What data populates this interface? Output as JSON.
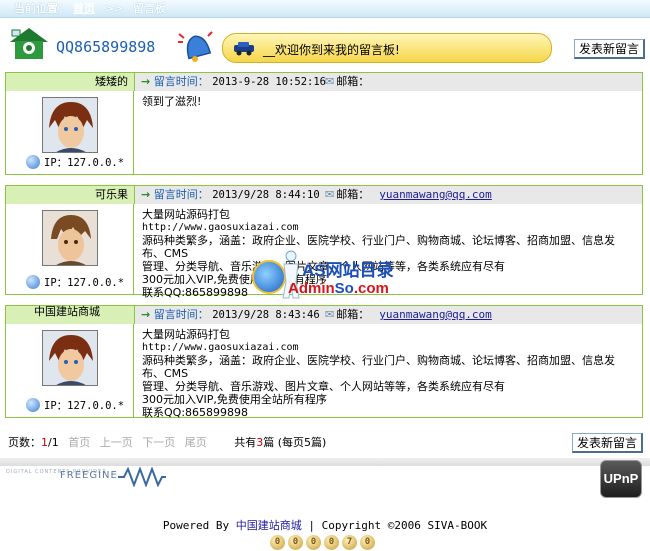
{
  "breadcrumb": {
    "label": "当前位置：",
    "home": "首页",
    "separator": ">>",
    "current": "留言板"
  },
  "header": {
    "qq": "QQ865899898",
    "welcome": "__欢迎你到来我的留言板!",
    "post_button": "发表新留言"
  },
  "labels": {
    "time": "留言时间：",
    "email": "邮箱：",
    "ip_prefix": "IP："
  },
  "messages": [
    {
      "name": "矮矮的",
      "time": "2013-9-28 10:52:16",
      "email": "",
      "ip": "127.0.0.*",
      "lines": [
        "领到了滋烈!"
      ]
    },
    {
      "name": "可乐果",
      "time": "2013/9/28 8:44:10",
      "email": "yuanmawang@qq.com",
      "ip": "127.0.0.*",
      "lines": [
        "大量网站源码打包",
        "http://www.gaosuxiazai.com",
        "源码种类繁多，涵盖：政府企业、医院学校、行业门户、购物商城、论坛博客、招商加盟、信息发布、CMS",
        "管理、分类导航、音乐游戏、图片文章、个人网站等等，各类系统应有尽有",
        "300元加入VIP,免费使用全站所有程序",
        "联系QQ:865899898"
      ]
    },
    {
      "name": "中国建站商城",
      "time": "2013/9/28 8:43:46",
      "email": "yuanmawang@qq.com",
      "ip": "127.0.0.*",
      "lines": [
        "大量网站源码打包",
        "http://www.gaosuxiazai.com",
        "源码种类繁多，涵盖：政府企业、医院学校、行业门户、购物商城、论坛博客、招商加盟、信息发布、CMS",
        "管理、分类导航、音乐游戏、图片文章、个人网站等等，各类系统应有尽有",
        "300元加入VIP,免费使用全站所有程序",
        "联系QQ:865899898"
      ]
    }
  ],
  "watermark": {
    "line1": "AS网站目录",
    "line2_a": "Admin",
    "line2_b": "So",
    "line2_c": ".com"
  },
  "pager": {
    "label": "页数：",
    "current": "1",
    "total_pages": "/1",
    "first": "首页",
    "prev": "上一页",
    "next": "下一页",
    "last": "尾页",
    "summary_a": "共有",
    "total": "3",
    "summary_b": "篇 (每页5篇)"
  },
  "footer": {
    "freegine_small": "DIGITAL CONTENTS PROVIDER",
    "freegine": "FREEGINE",
    "upnp": "UPnP",
    "powered": "Powered By ",
    "site": "中国建站商城",
    "copyright": " | Copyright ©2006 SIVA-BOOK",
    "counter": [
      "0",
      "0",
      "0",
      "0",
      "7",
      "0"
    ]
  },
  "colors": {
    "accent_green": "#8cc63f",
    "name_bg": "#d8efb6",
    "link_blue": "#1b1b9e",
    "welcome_yellow": "#f5d649"
  }
}
